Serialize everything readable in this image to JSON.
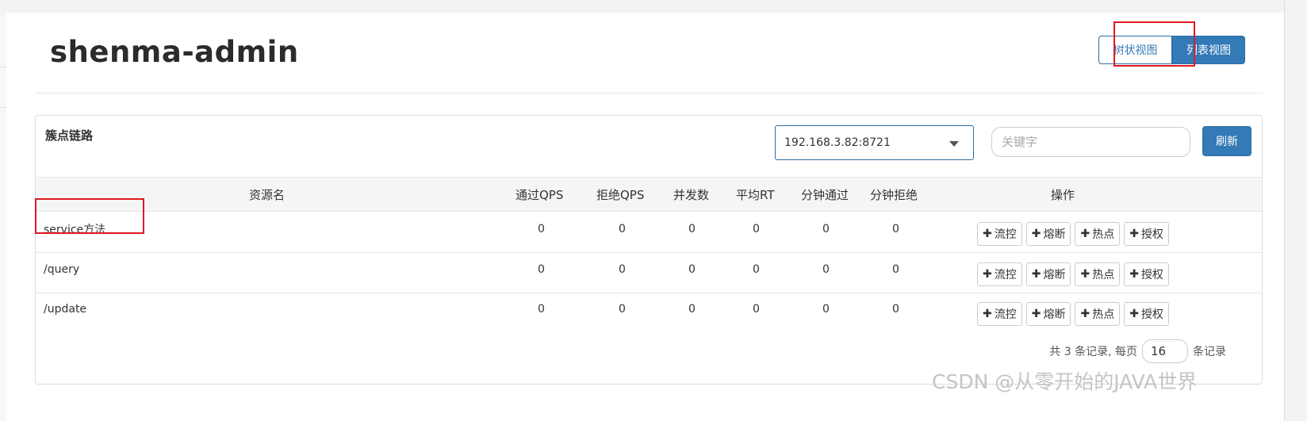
{
  "app": {
    "title": "shenma-admin"
  },
  "view_toggle": {
    "tree_label": "树状视图",
    "list_label": "列表视图",
    "active": "list"
  },
  "panel": {
    "title": "簇点链路",
    "machine": "192.168.3.82:8721",
    "search_placeholder": "关键字",
    "refresh_label": "刷新"
  },
  "table": {
    "columns": [
      "资源名",
      "通过QPS",
      "拒绝QPS",
      "并发数",
      "平均RT",
      "分钟通过",
      "分钟拒绝",
      "操作"
    ],
    "rows": [
      {
        "name": "service方法",
        "pass_qps": "0",
        "block_qps": "0",
        "concurrency": "0",
        "avg_rt": "0",
        "min_pass": "0",
        "min_block": "0"
      },
      {
        "name": "/query",
        "pass_qps": "0",
        "block_qps": "0",
        "concurrency": "0",
        "avg_rt": "0",
        "min_pass": "0",
        "min_block": "0"
      },
      {
        "name": "/update",
        "pass_qps": "0",
        "block_qps": "0",
        "concurrency": "0",
        "avg_rt": "0",
        "min_pass": "0",
        "min_block": "0"
      }
    ],
    "actions": [
      "流控",
      "熔断",
      "热点",
      "授权"
    ],
    "action_icon": "plus-icon"
  },
  "pagination": {
    "prefix": "共 3 条记录, 每页",
    "page_size": "16",
    "suffix": "条记录"
  },
  "watermark": "CSDN @从零开始的JAVA世界",
  "colors": {
    "primary": "#337ab7",
    "annotation": "#e0191f"
  }
}
